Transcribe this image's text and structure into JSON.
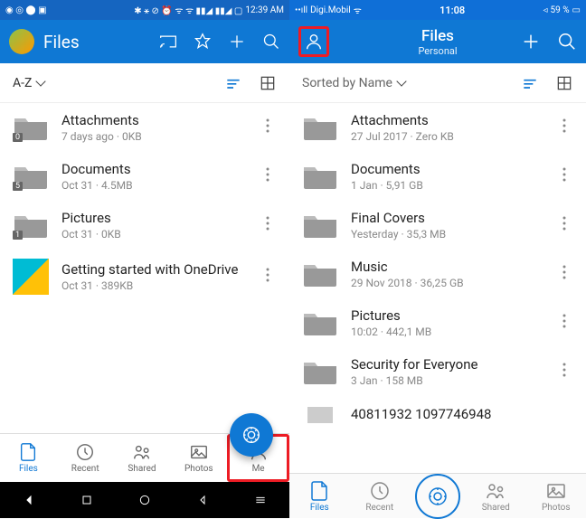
{
  "left": {
    "status": {
      "time": "12:39 AM"
    },
    "header": {
      "title": "Files"
    },
    "sort": "A-Z",
    "items": [
      {
        "name": "Attachments",
        "meta": "7 days ago · 0KB",
        "badge": "0",
        "type": "folder"
      },
      {
        "name": "Documents",
        "meta": "Oct 31 · 4.5MB",
        "badge": "5",
        "type": "folder"
      },
      {
        "name": "Pictures",
        "meta": "Oct 31 · 0KB",
        "badge": "1",
        "type": "folder"
      },
      {
        "name": "Getting started with OneDrive",
        "meta": "Oct 31 · 389KB",
        "type": "file"
      }
    ],
    "tabs": [
      "Files",
      "Recent",
      "Shared",
      "Photos",
      "Me"
    ]
  },
  "right": {
    "status": {
      "carrier": "Digi.Mobil",
      "time": "11:08",
      "battery": "59 %"
    },
    "header": {
      "title": "Files",
      "subtitle": "Personal"
    },
    "sort": "Sorted by Name",
    "items": [
      {
        "name": "Attachments",
        "meta": "27 Jul 2017 · Zero KB"
      },
      {
        "name": "Documents",
        "meta": "1 Jan · 5,91 GB"
      },
      {
        "name": "Final Covers",
        "meta": "Yesterday · 35,3 MB"
      },
      {
        "name": "Music",
        "meta": "29 Nov 2018 · 36,25 GB"
      },
      {
        "name": "Pictures",
        "meta": "10:02 · 442,1 MB"
      },
      {
        "name": "Security for Everyone",
        "meta": "3 Jan · 158 MB"
      },
      {
        "name": "40811932 1097746948",
        "meta": ""
      }
    ],
    "tabs": [
      "Files",
      "Recent",
      "Shared",
      "Photos"
    ]
  }
}
